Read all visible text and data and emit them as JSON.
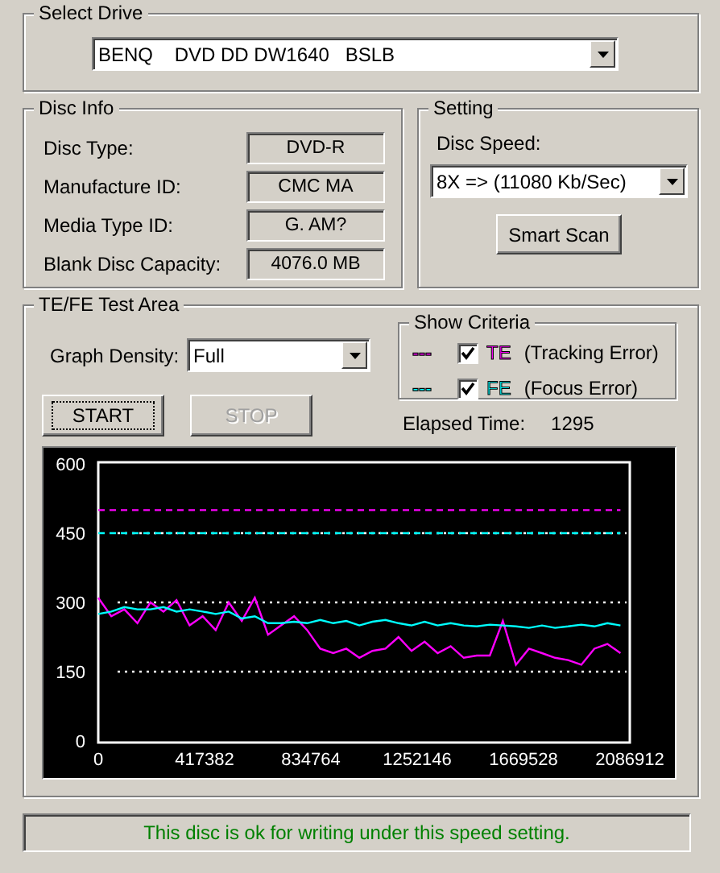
{
  "select_drive": {
    "title": "Select Drive",
    "drive": "BENQ    DVD DD DW1640   BSLB"
  },
  "disc_info": {
    "title": "Disc Info",
    "fields": [
      {
        "label": "Disc Type:",
        "value": "DVD-R"
      },
      {
        "label": "Manufacture ID:",
        "value": "CMC MA"
      },
      {
        "label": "Media Type ID:",
        "value": "G. AM?"
      },
      {
        "label": "Blank Disc Capacity:",
        "value": "4076.0 MB"
      }
    ]
  },
  "setting": {
    "title": "Setting",
    "disc_speed_label": "Disc Speed:",
    "disc_speed": "8X => (11080 Kb/Sec)",
    "smart_scan_button": "Smart Scan"
  },
  "test_area": {
    "title": "TE/FE Test Area",
    "graph_density_label": "Graph Density:",
    "graph_density": "Full",
    "show_criteria": {
      "title": "Show Criteria",
      "items": [
        {
          "marker": "---",
          "description": "(Tracking Error)",
          "checked": true
        },
        {
          "marker": "---",
          "description": "(Focus Error)",
          "checked": true
        }
      ]
    },
    "start_button": {
      "label": "START",
      "disabled": false
    },
    "stop_button": {
      "label": "STOP",
      "disabled": true
    },
    "elapsed_label": "Elapsed Time:",
    "elapsed": "1295",
    "chart_data": {
      "type": "line",
      "xlim": [
        0,
        2086912
      ],
      "ylim": [
        0,
        600
      ],
      "xticks": [
        0,
        417382,
        834764,
        1252146,
        1669528,
        2086912
      ],
      "yticks": [
        0,
        150,
        300,
        450,
        600
      ],
      "x": [
        0,
        51250,
        102500,
        153750,
        205000,
        256250,
        307500,
        358750,
        410000,
        461250,
        512500,
        563750,
        615000,
        666250,
        717500,
        768750,
        820000,
        871250,
        922500,
        973750,
        1025000,
        1076250,
        1127500,
        1178750,
        1230000,
        1281250,
        1332500,
        1383750,
        1435000,
        1486250,
        1537500,
        1588750,
        1640000,
        1691250,
        1742500,
        1793750,
        1845000,
        1896250,
        1947500,
        1998750,
        2050000
      ],
      "series": [
        {
          "name": "TE",
          "color": "#ff00ff",
          "values": [
            310,
            270,
            285,
            255,
            300,
            280,
            305,
            250,
            270,
            240,
            300,
            260,
            310,
            230,
            250,
            270,
            240,
            200,
            190,
            200,
            180,
            195,
            200,
            225,
            195,
            215,
            190,
            205,
            180,
            185,
            185,
            260,
            165,
            200,
            190,
            180,
            175,
            165,
            200,
            210,
            190
          ]
        },
        {
          "name": "FE",
          "color": "#00ffff",
          "values": [
            275,
            280,
            290,
            285,
            285,
            290,
            280,
            285,
            280,
            275,
            280,
            265,
            270,
            255,
            255,
            258,
            255,
            262,
            255,
            260,
            250,
            258,
            262,
            255,
            250,
            258,
            250,
            255,
            250,
            248,
            252,
            250,
            248,
            245,
            250,
            245,
            248,
            252,
            248,
            255,
            250
          ]
        },
        {
          "color": "#ff00ff",
          "line_style": "dashed",
          "values": [
            500,
            500,
            500,
            500,
            500,
            500,
            500,
            500,
            500,
            500,
            500,
            500,
            500,
            500,
            500,
            500,
            500,
            500,
            500,
            500,
            500,
            500,
            500,
            500,
            500,
            500,
            500,
            500,
            500,
            500,
            500,
            500,
            500,
            500,
            500,
            500,
            500,
            500,
            500,
            500,
            500
          ]
        },
        {
          "color": "#00ffff",
          "line_style": "dashed",
          "values": [
            450,
            450,
            450,
            450,
            450,
            450,
            450,
            450,
            450,
            450,
            450,
            450,
            450,
            450,
            450,
            450,
            450,
            450,
            450,
            450,
            450,
            450,
            450,
            450,
            450,
            450,
            450,
            450,
            450,
            450,
            450,
            450,
            450,
            450,
            450,
            450,
            450,
            450,
            450,
            450,
            450
          ]
        }
      ],
      "grid": true
    }
  },
  "status": "This disc is ok for writing under this speed setting."
}
